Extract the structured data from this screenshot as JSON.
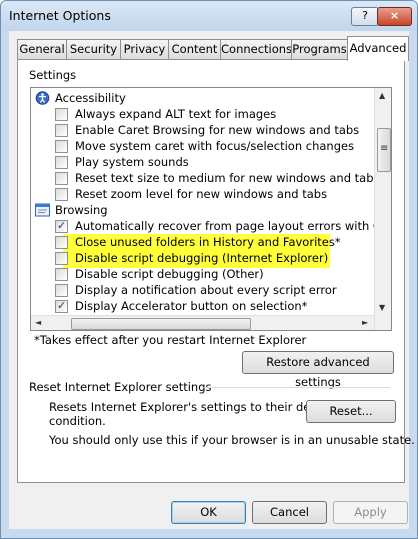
{
  "window": {
    "title": "Internet Options",
    "help_glyph": "?",
    "close_glyph": "×"
  },
  "tabs": [
    {
      "label": "General"
    },
    {
      "label": "Security"
    },
    {
      "label": "Privacy"
    },
    {
      "label": "Content"
    },
    {
      "label": "Connections"
    },
    {
      "label": "Programs"
    },
    {
      "label": "Advanced",
      "active": true
    }
  ],
  "advanced": {
    "settings_label": "Settings",
    "categories": {
      "accessibility": "Accessibility",
      "browsing": "Browsing"
    },
    "accessibility_items": [
      {
        "label": "Always expand ALT text for images",
        "checked": false
      },
      {
        "label": "Enable Caret Browsing for new windows and tabs",
        "checked": false
      },
      {
        "label": "Move system caret with focus/selection changes",
        "checked": false
      },
      {
        "label": "Play system sounds",
        "checked": false
      },
      {
        "label": "Reset text size to medium for new windows and tabs",
        "checked": false
      },
      {
        "label": "Reset zoom level for new windows and tabs",
        "checked": false
      }
    ],
    "browsing_items": [
      {
        "label": "Automatically recover from page layout errors with Compa",
        "checked": true
      },
      {
        "label": "Close unused folders in History and Favorites*",
        "checked": false
      },
      {
        "label": "Disable script debugging (Internet Explorer)",
        "checked": false,
        "highlighted": true
      },
      {
        "label": "Disable script debugging (Other)",
        "checked": false,
        "highlighted": true
      },
      {
        "label": "Display a notification about every script error",
        "checked": false
      },
      {
        "label": "Display Accelerator button on selection*",
        "checked": true
      }
    ],
    "restart_note": "*Takes effect after you restart Internet Explorer",
    "restore_button": "Restore advanced settings",
    "reset_section_title": "Reset Internet Explorer settings",
    "reset_description": "Resets Internet Explorer's settings to their default condition.",
    "reset_description_line1": "Resets Internet Explorer's settings to their default",
    "reset_description_line2": "condition.",
    "reset_button": "Reset...",
    "reset_warning": "You should only use this if your browser is in an unusable state.",
    "scroll_glyphs": {
      "up": "▲",
      "down": "▼",
      "left": "◄",
      "right": "►",
      "grip": "≡"
    }
  },
  "footer": {
    "ok": "OK",
    "cancel": "Cancel",
    "apply": "Apply"
  }
}
